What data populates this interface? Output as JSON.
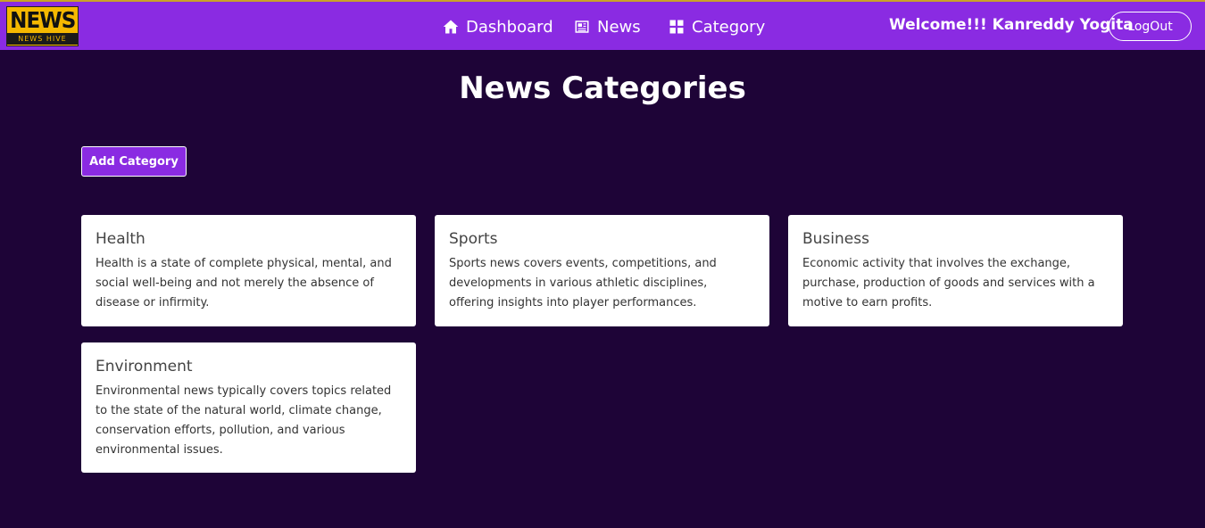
{
  "logo": {
    "main": "NEWS",
    "sub": "NEWS HIVE"
  },
  "nav": {
    "dashboard": "Dashboard",
    "news": "News",
    "category": "Category"
  },
  "header": {
    "welcome": "Welcome!!! Kanreddy Yogita",
    "logout": "LogOut"
  },
  "page": {
    "title": "News Categories",
    "add_button": "Add Category"
  },
  "categories": [
    {
      "title": "Health",
      "description": "Health is a state of complete physical, mental, and social well-being and not merely the absence of disease or infirmity."
    },
    {
      "title": "Sports",
      "description": "Sports news covers events, competitions, and developments in various athletic disciplines, offering insights into player performances."
    },
    {
      "title": "Business",
      "description": "Economic activity that involves the exchange, purchase, production of goods and services with a motive to earn profits."
    },
    {
      "title": "Environment",
      "description": "Environmental news typically covers topics related to the state of the natural world, climate change, conservation efforts, pollution, and various environmental issues."
    }
  ],
  "colors": {
    "navbar": "#8a2be2",
    "background": "#1e0437",
    "logo": "#f5b800",
    "card": "#ffffff"
  },
  "icons": {
    "dashboard": "home-icon",
    "news": "newspaper-icon",
    "category": "grid-icon"
  }
}
